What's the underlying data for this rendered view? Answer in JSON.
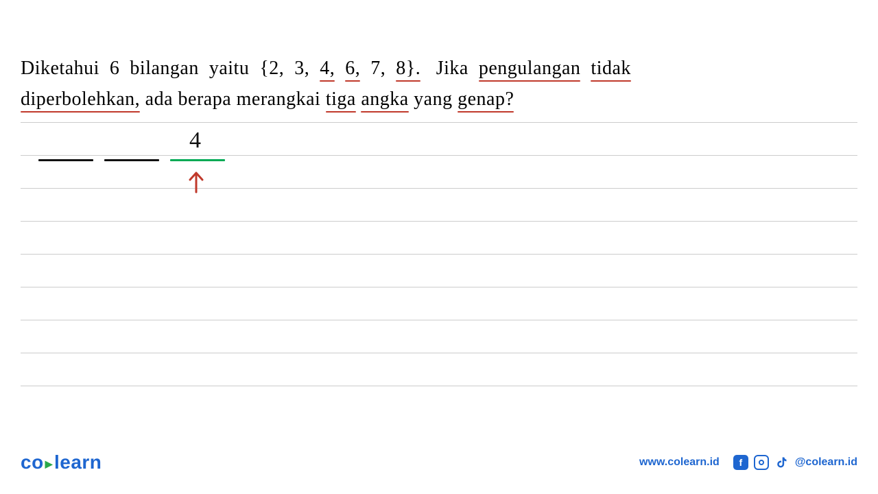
{
  "question": {
    "segments": [
      {
        "text": "Diketahui",
        "u": false
      },
      {
        "text": "6",
        "u": false
      },
      {
        "text": "bilangan",
        "u": false
      },
      {
        "text": "yaitu",
        "u": false
      },
      {
        "text": "{2,",
        "u": false
      },
      {
        "text": "3,",
        "u": false
      },
      {
        "text": "4,",
        "u": true
      },
      {
        "text": "6,",
        "u": true
      },
      {
        "text": "7,",
        "u": false
      },
      {
        "text": "8}.",
        "u": true
      },
      {
        "text": "Jika",
        "u": false
      },
      {
        "text": "pengulangan",
        "u": true
      },
      {
        "text": "tidak",
        "u": true
      },
      {
        "text": "diperbolehkan,",
        "u": true
      },
      {
        "text": "ada",
        "u": false
      },
      {
        "text": "berapa",
        "u": false
      },
      {
        "text": "merangkai",
        "u": false
      },
      {
        "text": "tiga",
        "u": true
      },
      {
        "text": "angka",
        "u": true
      },
      {
        "text": "yang",
        "u": false
      },
      {
        "text": "genap?",
        "u": true
      }
    ]
  },
  "handwriting": {
    "answer_digit": "4"
  },
  "footer": {
    "logo_co": "co",
    "logo_learn": "learn",
    "url": "www.colearn.id",
    "handle": "@colearn.id",
    "fb_glyph": "f"
  }
}
